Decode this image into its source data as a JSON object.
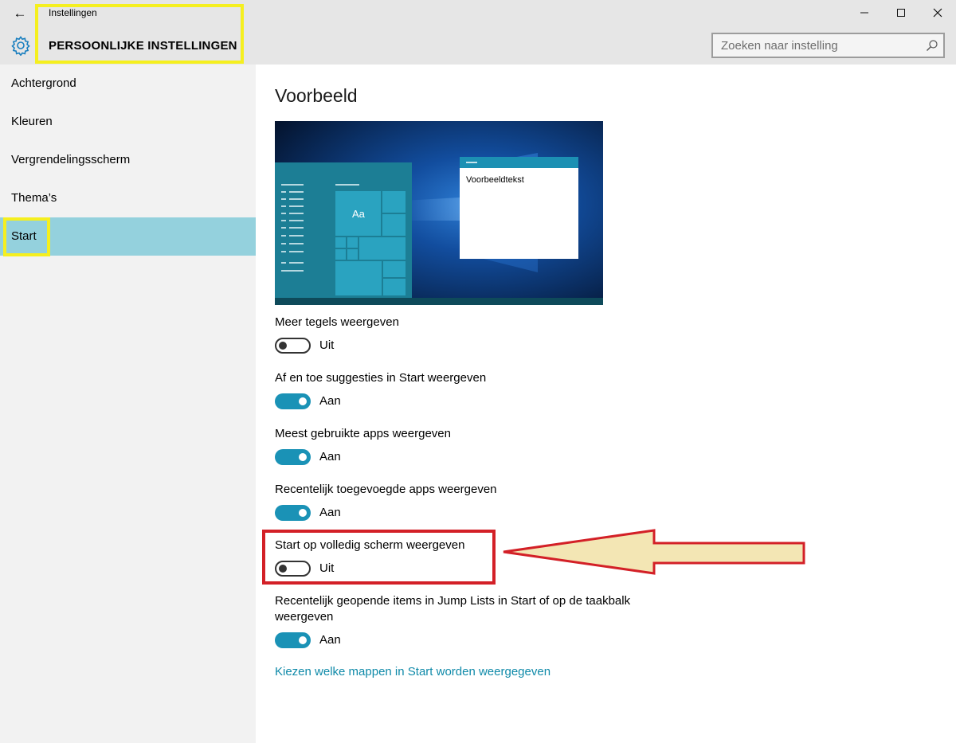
{
  "window": {
    "app_title": "Instellingen",
    "section_title": "PERSOONLIJKE INSTELLINGEN",
    "back_label": "←",
    "minimize_label": "—",
    "maximize_label": "☐",
    "close_label": "✕"
  },
  "search": {
    "placeholder": "Zoeken naar instelling"
  },
  "sidebar": {
    "items": [
      {
        "label": "Achtergrond"
      },
      {
        "label": "Kleuren"
      },
      {
        "label": "Vergrendelingsscherm"
      },
      {
        "label": "Thema’s"
      },
      {
        "label": "Start"
      }
    ],
    "active_index": 4
  },
  "main": {
    "heading": "Voorbeeld",
    "preview": {
      "sample_text": "Voorbeeldtekst",
      "tile_text": "Aa"
    },
    "settings": [
      {
        "label": "Meer tegels weergeven",
        "state": "Uit",
        "on": false
      },
      {
        "label": "Af en toe suggesties in Start weergeven",
        "state": "Aan",
        "on": true
      },
      {
        "label": "Meest gebruikte apps weergeven",
        "state": "Aan",
        "on": true
      },
      {
        "label": "Recentelijk toegevoegde apps weergeven",
        "state": "Aan",
        "on": true
      },
      {
        "label": "Start op volledig scherm weergeven",
        "state": "Uit",
        "on": false
      },
      {
        "label_line1": "Recentelijk geopende items in Jump Lists in Start of op de taakbalk",
        "label_line2": "weergeven",
        "state": "Aan",
        "on": true
      }
    ],
    "link": "Kiezen welke mappen in Start worden weergegeven"
  },
  "colors": {
    "accent": "#1a92b6",
    "active_nav": "#94d1dd",
    "highlight_yellow": "#f5ef1f",
    "highlight_red": "#d32027",
    "arrow_fill": "#f3e6b4"
  }
}
